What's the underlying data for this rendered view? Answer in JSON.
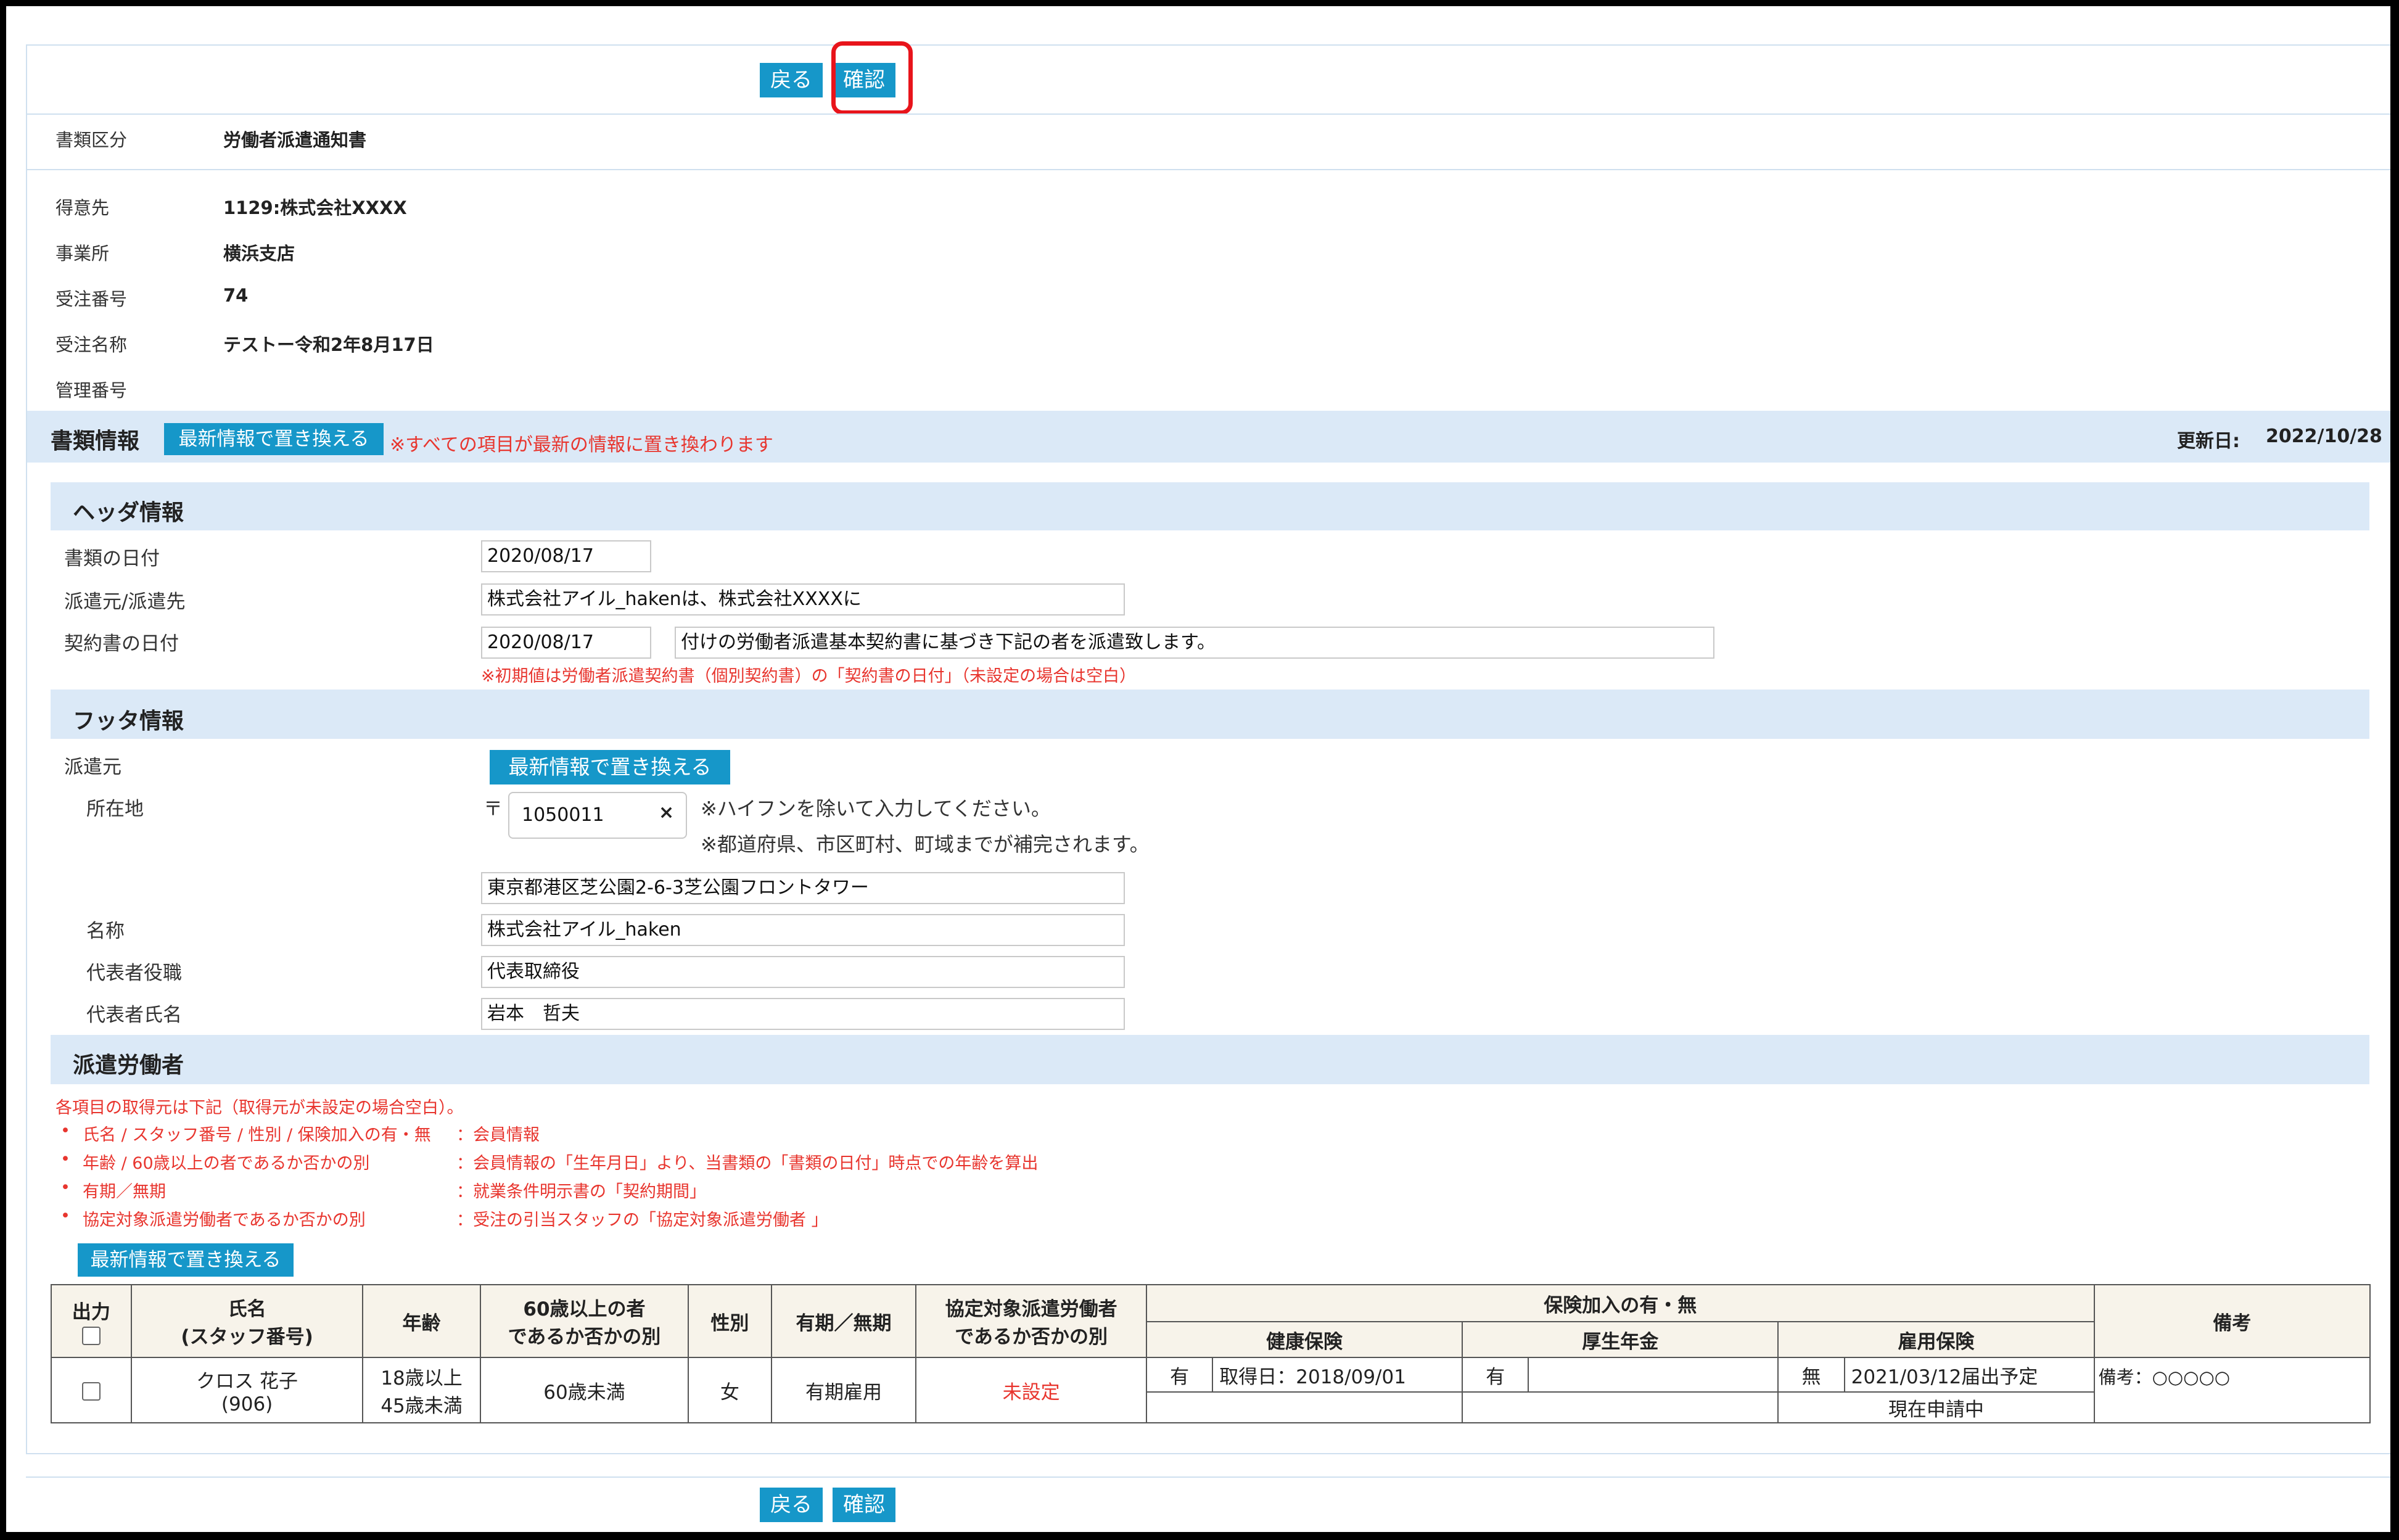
{
  "toolbar": {
    "back_label": "戻る",
    "confirm_label": "確認"
  },
  "meta": {
    "doc_type_label": "書類区分",
    "doc_type_value": "労働者派遣通知書",
    "customer_label": "得意先",
    "customer_value": "1129:株式会社XXXX",
    "office_label": "事業所",
    "office_value": "横浜支店",
    "order_no_label": "受注番号",
    "order_no_value": "74",
    "order_name_label": "受注名称",
    "order_name_value": "テストー令和2年8月17日",
    "manage_no_label": "管理番号",
    "manage_no_value": ""
  },
  "doc_info": {
    "title": "書類情報",
    "replace_label": "最新情報で置き換える",
    "warning": "※すべての項目が最新の情報に置き換わります",
    "updated_label": "更新日:",
    "updated_value": "2022/10/28"
  },
  "header_info": {
    "title": "ヘッダ情報",
    "doc_date_label": "書類の日付",
    "doc_date_value": "2020/08/17",
    "dispatch_label": "派遣元/派遣先",
    "dispatch_value": "株式会社アイル_hakenは、株式会社XXXXに",
    "contract_date_label": "契約書の日付",
    "contract_date_value": "2020/08/17",
    "contract_text_value": "付けの労働者派遣基本契約書に基づき下記の者を派遣致します。",
    "contract_note": "※初期値は労働者派遣契約書（個別契約書）の「契約書の日付」（未設定の場合は空白）"
  },
  "footer_info": {
    "title": "フッタ情報",
    "source_label": "派遣元",
    "replace_label": "最新情報で置き換える",
    "address_label": "所在地",
    "postal_mark": "〒",
    "postal_value": "1050011",
    "clear_icon": "×",
    "postal_note1": "※ハイフンを除いて入力してください。",
    "postal_note2": "※都道府県、市区町村、町域までが補完されます。",
    "address_value": "東京都港区芝公園2-6-3芝公園フロントタワー",
    "name_label": "名称",
    "name_value": "株式会社アイル_haken",
    "rep_title_label": "代表者役職",
    "rep_title_value": "代表取締役",
    "rep_name_label": "代表者氏名",
    "rep_name_value": "岩本　哲夫"
  },
  "workers": {
    "title": "派遣労働者",
    "intro": "各項目の取得元は下記（取得元が未設定の場合空白）。",
    "sources": [
      {
        "item": "氏名 / スタッフ番号 / 性別 / 保険加入の有・無",
        "source": "：会員情報"
      },
      {
        "item": "年齢 / 60歳以上の者であるか否かの別",
        "source": "：会員情報の「生年月日」より、当書類の「書類の日付」時点での年齢を算出"
      },
      {
        "item": "有期／無期",
        "source": "：就業条件明示書の「契約期間」"
      },
      {
        "item": "協定対象派遣労働者であるか否かの別",
        "source": "：受注の引当スタッフの「協定対象派遣労働者 」"
      }
    ],
    "replace_label": "最新情報で置き換える",
    "headers": {
      "output": "出力",
      "name1": "氏名",
      "name2": "(スタッフ番号)",
      "age": "年齢",
      "over60_1": "60歳以上の者",
      "over60_2": "であるか否かの別",
      "gender": "性別",
      "term": "有期／無期",
      "agreement1": "協定対象派遣労働者",
      "agreement2": "であるか否かの別",
      "insurance": "保険加入の有・無",
      "health": "健康保険",
      "pension": "厚生年金",
      "employment": "雇用保険",
      "remarks": "備考"
    },
    "row": {
      "name": "クロス 花子",
      "staff_no": "(906)",
      "age1": "18歳以上",
      "age2": "45歳未満",
      "over60": "60歳未満",
      "gender": "女",
      "term": "有期雇用",
      "agreement": "未設定",
      "health_flag": "有",
      "health_date": "取得日：2018/09/01",
      "pension_flag": "有",
      "pension_date": "",
      "employment_flag": "無",
      "employment_date": "2021/03/12届出予定",
      "employment_status": "現在申請中",
      "remarks": "備考：○○○○○"
    }
  }
}
